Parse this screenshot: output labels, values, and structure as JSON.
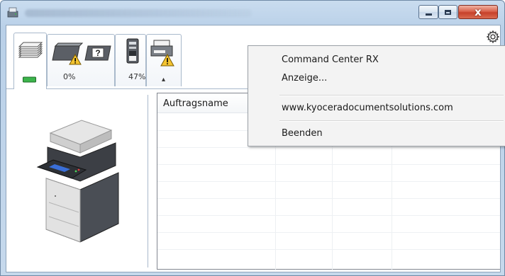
{
  "window": {
    "title": "",
    "controls": {
      "minimize": "minimize",
      "maximize": "maximize",
      "close": "x"
    }
  },
  "tabs": [
    {
      "name": "print-jobs",
      "icon": "document-stack-icon",
      "label": ""
    },
    {
      "name": "toner",
      "icon": "toner-warning-icon",
      "label": "0%"
    },
    {
      "name": "paper",
      "icon": "paper-tray-icon",
      "label": "47%"
    },
    {
      "name": "device-status",
      "icon": "printer-warning-icon",
      "label": ""
    }
  ],
  "collapse_glyph": "▴",
  "job_list": {
    "columns": [
      "Auftragsname"
    ]
  },
  "context_menu": {
    "items": [
      {
        "label": "Command Center RX"
      },
      {
        "label": "Anzeige..."
      },
      {
        "label": "www.kyoceradocumentsolutions.com"
      },
      {
        "label": "Beenden"
      }
    ]
  },
  "colors": {
    "accent_green": "#3cb44b",
    "warning": "#f4c430",
    "close_button": "#c7412a"
  }
}
